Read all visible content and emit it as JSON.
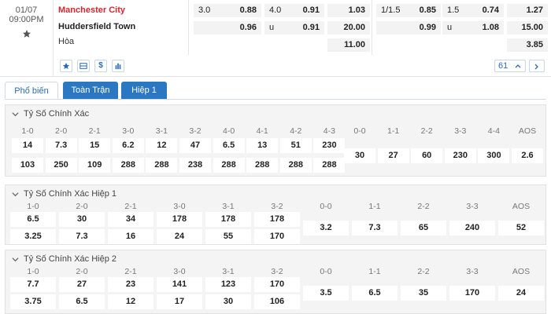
{
  "match": {
    "date": "01/07",
    "time": "09:00PM",
    "home": "Manchester City",
    "away": "Huddersfield Town",
    "draw_label": "Hòa",
    "home_color": "#d7262e"
  },
  "odds": {
    "ft_handicap": {
      "line": "3.0",
      "home": "0.88",
      "away": "0.96"
    },
    "ft_overunder": {
      "line": "4.0",
      "over": "0.91",
      "under_label": "u",
      "under": "0.91"
    },
    "ft_1x2": {
      "home": "1.03",
      "away": "20.00",
      "draw": "11.00"
    },
    "h1_handicap": {
      "line": "1/1.5",
      "home": "0.85",
      "away": "0.99"
    },
    "h1_overunder": {
      "line": "1.5",
      "over": "0.74",
      "under_label": "u",
      "under": "1.08"
    },
    "h1_1x2": {
      "home": "1.27",
      "away": "15.00",
      "draw": "3.85"
    }
  },
  "toolbar": {
    "icons": [
      "star-icon",
      "list-icon",
      "dollar-icon",
      "chart-icon"
    ],
    "dollar_glyph": "$",
    "market_count": "61"
  },
  "tabs": [
    {
      "label": "Phổ biến",
      "active": true
    },
    {
      "label": "Toàn Trận",
      "active": false
    },
    {
      "label": "Hiệp 1",
      "active": false
    }
  ],
  "sections": [
    {
      "title": "Tỷ Số Chính Xác",
      "home_labels": [
        "1-0",
        "2-0",
        "2-1",
        "3-0",
        "3-1",
        "3-2",
        "4-0",
        "4-1",
        "4-2",
        "4-3"
      ],
      "home_values": [
        "14",
        "7.3",
        "15",
        "6.2",
        "12",
        "47",
        "6.5",
        "13",
        "51",
        "230"
      ],
      "away_values": [
        "103",
        "250",
        "109",
        "288",
        "288",
        "238",
        "288",
        "288",
        "288",
        "288"
      ],
      "draw_labels": [
        "0-0",
        "1-1",
        "2-2",
        "3-3",
        "4-4",
        "AOS"
      ],
      "draw_values": [
        "30",
        "27",
        "60",
        "230",
        "300",
        "2.6"
      ]
    },
    {
      "title": "Tỷ Số Chính Xác Hiệp 1",
      "home_labels": [
        "1-0",
        "2-0",
        "2-1",
        "3-0",
        "3-1",
        "3-2"
      ],
      "home_values": [
        "6.5",
        "30",
        "34",
        "178",
        "178",
        "178"
      ],
      "away_values": [
        "3.25",
        "7.3",
        "16",
        "24",
        "55",
        "170"
      ],
      "draw_labels": [
        "0-0",
        "1-1",
        "2-2",
        "3-3",
        "AOS"
      ],
      "draw_values": [
        "3.2",
        "7.3",
        "65",
        "240",
        "52"
      ]
    },
    {
      "title": "Tỷ Số Chính Xác Hiệp 2",
      "home_labels": [
        "1-0",
        "2-0",
        "2-1",
        "3-0",
        "3-1",
        "3-2"
      ],
      "home_values": [
        "7.7",
        "27",
        "23",
        "141",
        "123",
        "170"
      ],
      "away_values": [
        "3.75",
        "6.5",
        "12",
        "17",
        "30",
        "106"
      ],
      "draw_labels": [
        "0-0",
        "1-1",
        "2-2",
        "3-3",
        "AOS"
      ],
      "draw_values": [
        "3.5",
        "6.5",
        "35",
        "170",
        "24"
      ]
    }
  ]
}
